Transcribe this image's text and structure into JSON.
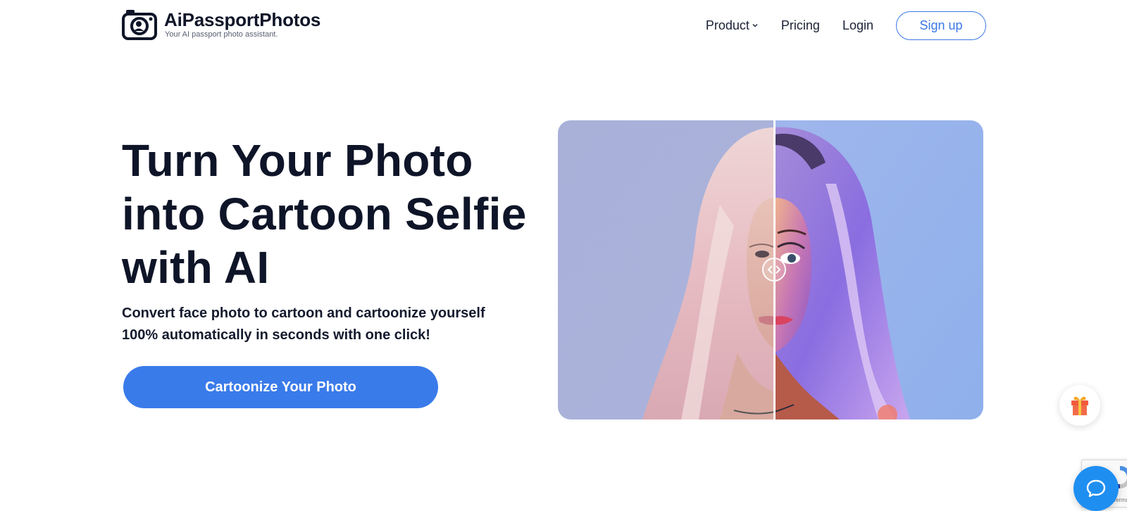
{
  "brand": {
    "name": "AiPassportPhotos",
    "tagline": "Your AI passport photo assistant."
  },
  "nav": {
    "items": [
      {
        "label": "Product",
        "has_dropdown": true,
        "icon": "chevron-down-icon"
      },
      {
        "label": "Pricing",
        "has_dropdown": false
      },
      {
        "label": "Login",
        "has_dropdown": false
      }
    ],
    "signup_label": "Sign up"
  },
  "hero": {
    "title": "Turn Your Photo into Cartoon Selfie with AI",
    "subtitle": "Convert face photo to cartoon and cartoonize yourself 100% automatically in seconds with one click!",
    "cta_label": "Cartoonize Your Photo"
  },
  "compare": {
    "handle_icon": "compare-arrows-icon",
    "divider_position": 0.51
  },
  "widgets": {
    "gift_icon": "gift-icon",
    "recaptcha_text": "Terms",
    "chat_icon": "chat-bubble-icon"
  },
  "colors": {
    "primary": "#3a7bea",
    "text_dark": "#0f1528",
    "chat": "#1f8ef1"
  }
}
